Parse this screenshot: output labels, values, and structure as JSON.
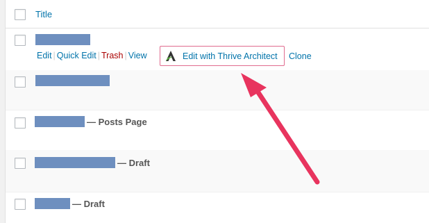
{
  "table": {
    "header": {
      "title_label": "Title"
    },
    "rows": [
      {
        "state": ""
      },
      {
        "state": ""
      },
      {
        "state": "— Posts Page"
      },
      {
        "state": "— Draft"
      },
      {
        "state": "— Draft"
      }
    ],
    "row_actions": {
      "edit": "Edit",
      "quick_edit": "Quick Edit",
      "trash": "Trash",
      "view": "View",
      "edit_thrive": "Edit with Thrive Architect",
      "clone": "Clone",
      "separator": "|"
    }
  },
  "colors": {
    "link": "#0073aa",
    "trash": "#aa0000",
    "highlight_border": "#e06b8e",
    "arrow": "#e8345e",
    "redaction": "#6e8fbf"
  },
  "icons": {
    "thrive_logo": "thrive-architect-logo-icon",
    "arrow": "annotation-arrow"
  }
}
